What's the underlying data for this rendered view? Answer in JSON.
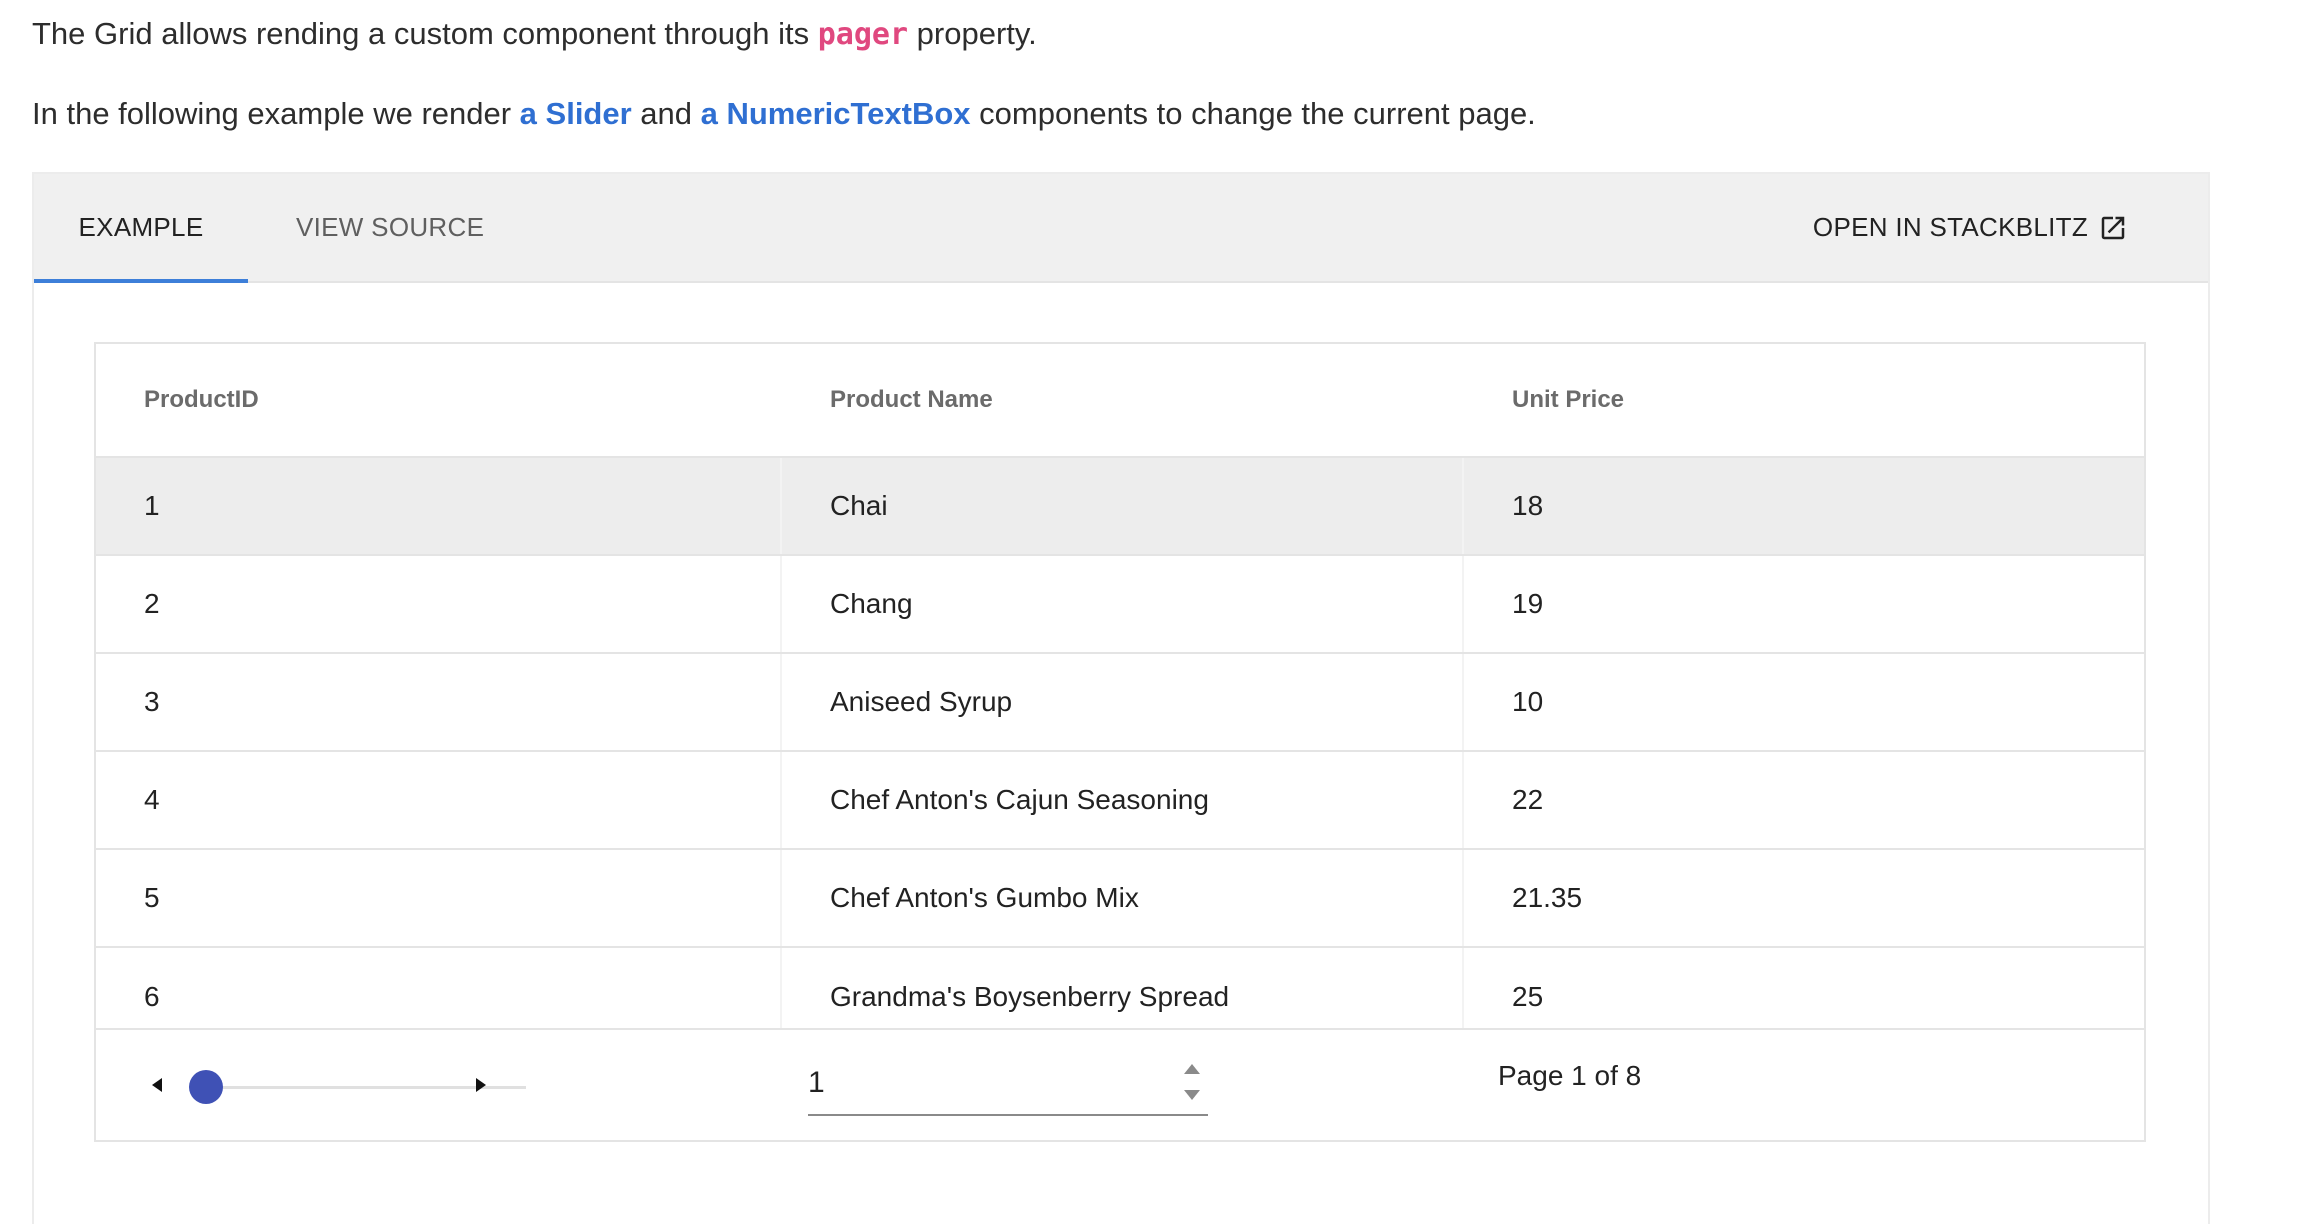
{
  "intro": {
    "line1_before": "The Grid allows rending a custom component through its ",
    "line1_code": "pager",
    "line1_after": " property.",
    "line2_before": "In the following example we render ",
    "line2_link1": "a Slider",
    "line2_mid": " and ",
    "line2_link2": "a NumericTextBox",
    "line2_after": " components to change the current page."
  },
  "tabs": {
    "example": "EXAMPLE",
    "view_source": "VIEW SOURCE",
    "open_stackblitz": "OPEN IN STACKBLITZ",
    "stackblitz_icon": "external-link-icon"
  },
  "grid": {
    "columns": [
      "ProductID",
      "Product Name",
      "Unit Price"
    ],
    "rows": [
      {
        "id": "1",
        "name": "Chai",
        "price": "18"
      },
      {
        "id": "2",
        "name": "Chang",
        "price": "19"
      },
      {
        "id": "3",
        "name": "Aniseed Syrup",
        "price": "10"
      },
      {
        "id": "4",
        "name": "Chef Anton's Cajun Seasoning",
        "price": "22"
      },
      {
        "id": "5",
        "name": "Chef Anton's Gumbo Mix",
        "price": "21.35"
      },
      {
        "id": "6",
        "name": "Grandma's Boysenberry Spread",
        "price": "25"
      }
    ]
  },
  "pager": {
    "slider_min": 1,
    "slider_max": 8,
    "slider_value": 1,
    "numeric_value": "1",
    "page_info": "Page 1 of 8"
  },
  "colors": {
    "accent": "#3d7fd9",
    "link": "#2f6fd2",
    "code": "#e0487f",
    "slider_thumb": "#3f51b5"
  }
}
